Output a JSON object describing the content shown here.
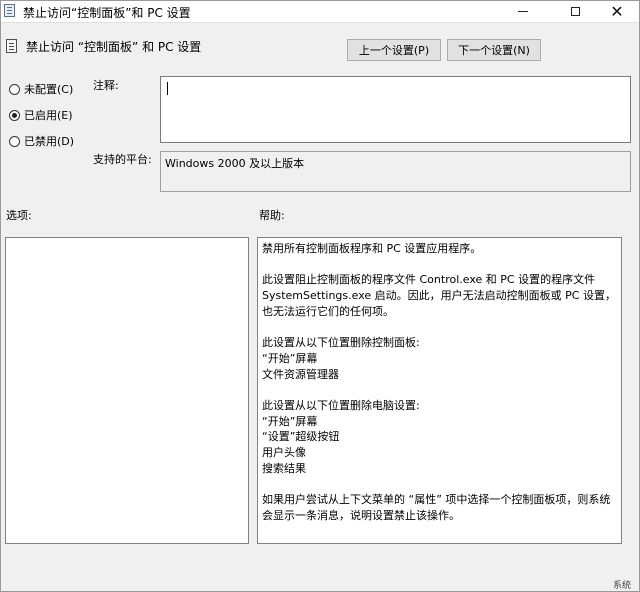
{
  "window": {
    "title": "禁止访问“控制面板”和 PC 设置",
    "app_icon": "policy-settings-icon"
  },
  "titlebar_buttons": {
    "minimize_icon": "minimize-icon",
    "maximize_icon": "maximize-icon",
    "close_icon": "close-icon",
    "close_glyph": "✕"
  },
  "header": {
    "title": "禁止访问 “控制面板” 和 PC 设置",
    "prev_button": "上一个设置(P)",
    "next_button": "下一个设置(N)"
  },
  "state_options": [
    {
      "label": "未配置(C)",
      "checked": false
    },
    {
      "label": "已启用(E)",
      "checked": true
    },
    {
      "label": "已禁用(D)",
      "checked": false
    }
  ],
  "comment": {
    "label": "注释:",
    "value": ""
  },
  "platform": {
    "label": "支持的平台:",
    "value": "Windows 2000 及以上版本"
  },
  "options": {
    "label": "选项:"
  },
  "help": {
    "label": "帮助:",
    "paragraphs": [
      [
        "禁用所有控制面板程序和 PC 设置应用程序。"
      ],
      [
        "此设置阻止控制面板的程序文件 Control.exe 和 PC 设置的程序文件",
        "SystemSettings.exe 启动。因此，用户无法启动控制面板或 PC 设置，",
        "也无法运行它们的任何项。"
      ],
      [
        "此设置从以下位置删除控制面板:",
        "“开始”屏幕",
        "文件资源管理器"
      ],
      [
        "此设置从以下位置删除电脑设置:",
        "“开始”屏幕",
        "“设置”超级按钮",
        "用户头像",
        "搜索结果"
      ],
      [
        "如果用户尝试从上下文菜单的 “属性” 项中选择一个控制面板项，则系统",
        "会显示一条消息，说明设置禁止该操作。"
      ]
    ]
  },
  "corner_text": "系统"
}
